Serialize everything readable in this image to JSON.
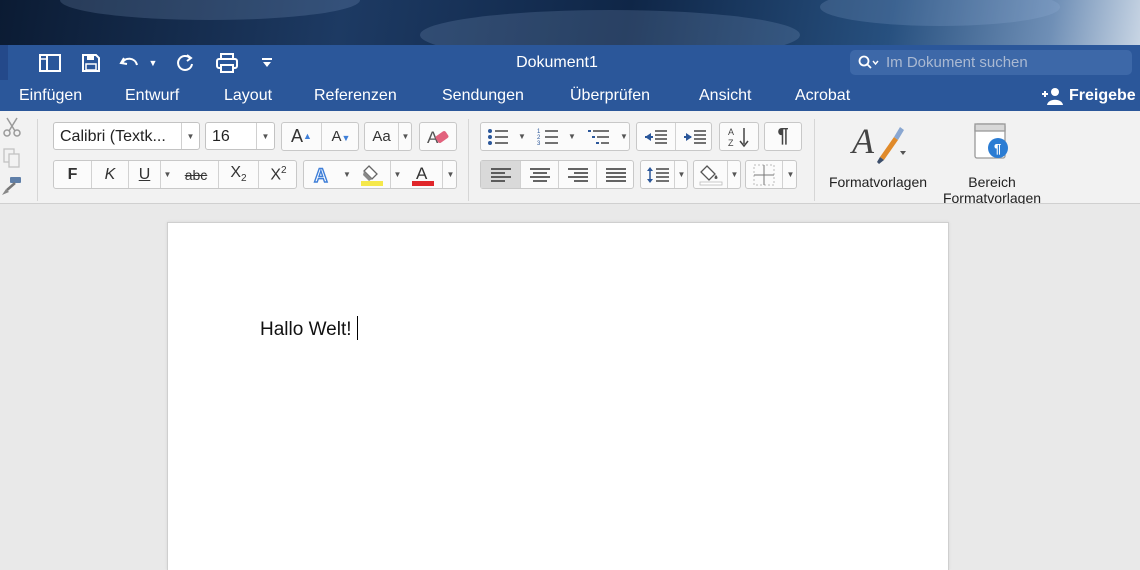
{
  "window": {
    "title": "Dokument1"
  },
  "search": {
    "placeholder": "Im Dokument suchen"
  },
  "tabs": [
    "Einfügen",
    "Entwurf",
    "Layout",
    "Referenzen",
    "Sendungen",
    "Überprüfen",
    "Ansicht",
    "Acrobat"
  ],
  "share": {
    "label": "Freigebe"
  },
  "font": {
    "name": "Calibri (Textk...",
    "size": "16"
  },
  "format_buttons": {
    "bold": "F",
    "italic": "K",
    "underline": "U",
    "strike": "abc",
    "sub": "X",
    "sub_index": "2",
    "sup": "X",
    "sup_index": "2"
  },
  "grow_font": {
    "letter": "A"
  },
  "shrink_font": {
    "letter": "A"
  },
  "change_case": {
    "label": "Aa"
  },
  "styles": {
    "label": "Formatvorlagen"
  },
  "styles_pane": {
    "label_line1": "Bereich",
    "label_line2": "Formatvorlagen"
  },
  "document": {
    "text": "Hallo Welt!"
  },
  "colors": {
    "ribbon_blue": "#2b579a",
    "highlight_yellow": "#f5e84a",
    "font_color_red": "#e0262a",
    "text_effect_blue": "#3f7fd8"
  }
}
